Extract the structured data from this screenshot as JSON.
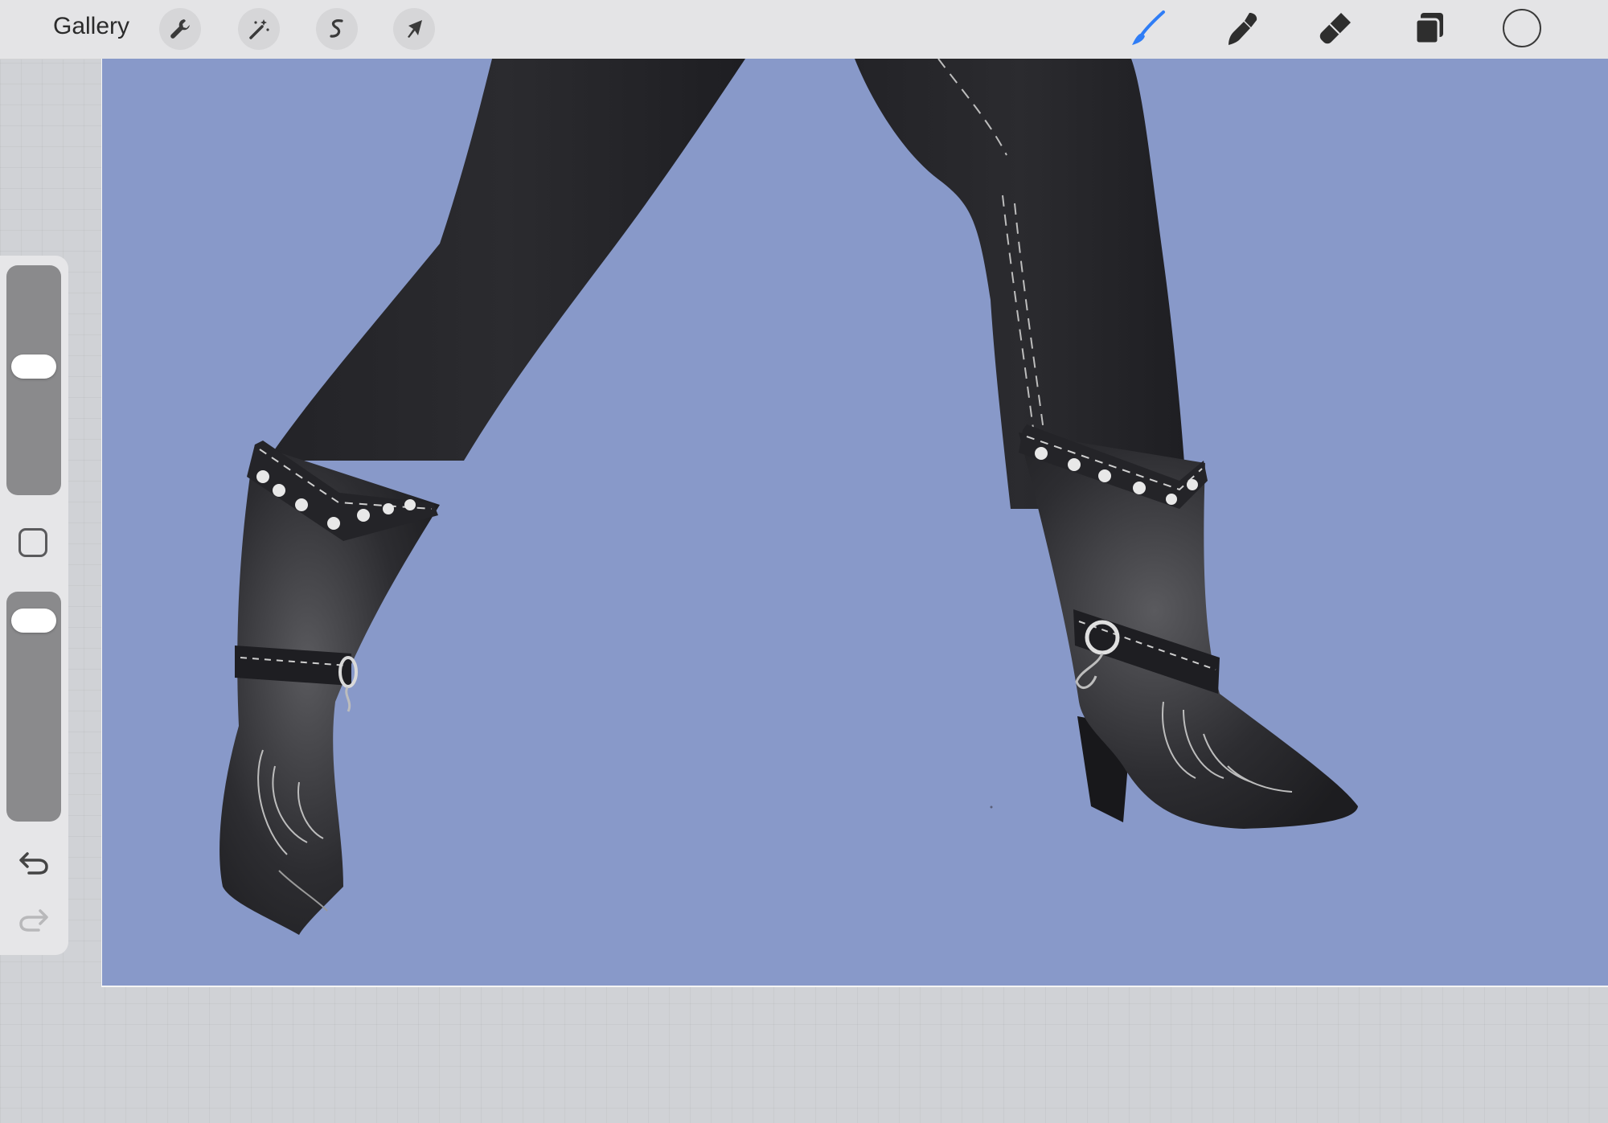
{
  "toolbar": {
    "gallery_label": "Gallery",
    "left_tools": [
      {
        "name": "actions",
        "icon": "wrench-icon"
      },
      {
        "name": "adjustments",
        "icon": "magic-wand-icon"
      },
      {
        "name": "selection",
        "icon": "selection-s-icon"
      },
      {
        "name": "transform",
        "icon": "arrow-cursor-icon"
      }
    ],
    "right_tools": [
      {
        "name": "brush",
        "icon": "brush-icon",
        "active": true
      },
      {
        "name": "smudge",
        "icon": "smudge-icon",
        "active": false
      },
      {
        "name": "eraser",
        "icon": "eraser-icon",
        "active": false
      },
      {
        "name": "layers",
        "icon": "layers-icon",
        "active": false
      }
    ],
    "active_color": "#e4e4e6",
    "accent_color": "#2f7df6"
  },
  "sidebar": {
    "brush_size_level": 0.57,
    "opacity_level": 0.95
  },
  "canvas": {
    "background_color": "#8899c9",
    "subject": "black-leather-cowboy-boots-illustration"
  }
}
